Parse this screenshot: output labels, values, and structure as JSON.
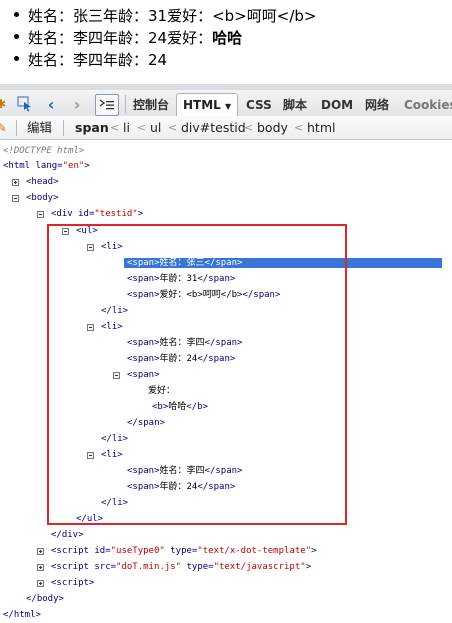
{
  "preview": {
    "items": [
      {
        "pre": "姓名：张三年龄：31爱好：",
        "post": "<b>呵呵</b>",
        "bold": ""
      },
      {
        "pre": "姓名：李四年龄：24爱好：",
        "post": "",
        "bold": "哈哈"
      },
      {
        "pre": "姓名：李四年龄：24",
        "post": "",
        "bold": ""
      }
    ]
  },
  "toolbar": {
    "tabs": [
      {
        "label": "控制台"
      },
      {
        "label": "HTML"
      },
      {
        "label": "CSS"
      },
      {
        "label": "脚本"
      },
      {
        "label": "DOM"
      },
      {
        "label": "网络"
      },
      {
        "label": "Cookies"
      }
    ],
    "active_tab": "HTML"
  },
  "breadcrumb": {
    "edit_label": "编辑",
    "items": [
      "span",
      "li",
      "ul",
      "div#testid",
      "body",
      "html"
    ]
  },
  "tree": {
    "doctype": "<!DOCTYPE html>",
    "lines": {
      "html_open": {
        "tag": "<html",
        "attr": " lang=",
        "val": "\"en\"",
        "end": ">"
      },
      "head": "<head>",
      "body": "<body>",
      "div_open": {
        "tag": "<div",
        "attr": " id=",
        "val": "\"testid\"",
        "end": ">"
      },
      "ul_open": "<ul>",
      "li1": "<li>",
      "li1_span1": {
        "open": "<span>",
        "text": "姓名：张三",
        "close": "</span>"
      },
      "li1_span2": {
        "open": "<span>",
        "text": "年龄：31",
        "close": "</span>"
      },
      "li1_span3": {
        "open": "<span>",
        "text": "爱好：<b>呵呵</b>",
        "close": "</span>"
      },
      "li1_close": "</li>",
      "li2": "<li>",
      "li2_span1": {
        "open": "<span>",
        "text": "姓名：李四",
        "close": "</span>"
      },
      "li2_span2": {
        "open": "<span>",
        "text": "年龄：24",
        "close": "</span>"
      },
      "li2_span3_open": "<span>",
      "li2_span3_text": "爱好：",
      "li2_b": {
        "open": "<b>",
        "text": "哈哈",
        "close": "</b>"
      },
      "li2_span3_close": "</span>",
      "li2_close": "</li>",
      "li3": "<li>",
      "li3_span1": {
        "open": "<span>",
        "text": "姓名：李四",
        "close": "</span>"
      },
      "li3_span2": {
        "open": "<span>",
        "text": "年龄：24",
        "close": "</span>"
      },
      "li3_close": "</li>",
      "ul_close": "</ul>",
      "div_close": "</div>",
      "script1": {
        "tag": "<script",
        "attr1": " id=",
        "val1": "\"useType0\"",
        "attr2": " type=",
        "val2": "\"text/x-dot-template\"",
        "end": ">"
      },
      "script2": {
        "tag": "<script",
        "attr1": " src=",
        "val1": "\"doT.min.js\"",
        "attr2": " type=",
        "val2": "\"text/javascript\"",
        "end": ">"
      },
      "script3": "<script>",
      "body_close": "</body>",
      "html_close": "</html>"
    }
  },
  "colors": {
    "highlight": "#e0262b",
    "selection": "#3875d7",
    "tag": "#000080",
    "attr_value": "#c00000"
  }
}
